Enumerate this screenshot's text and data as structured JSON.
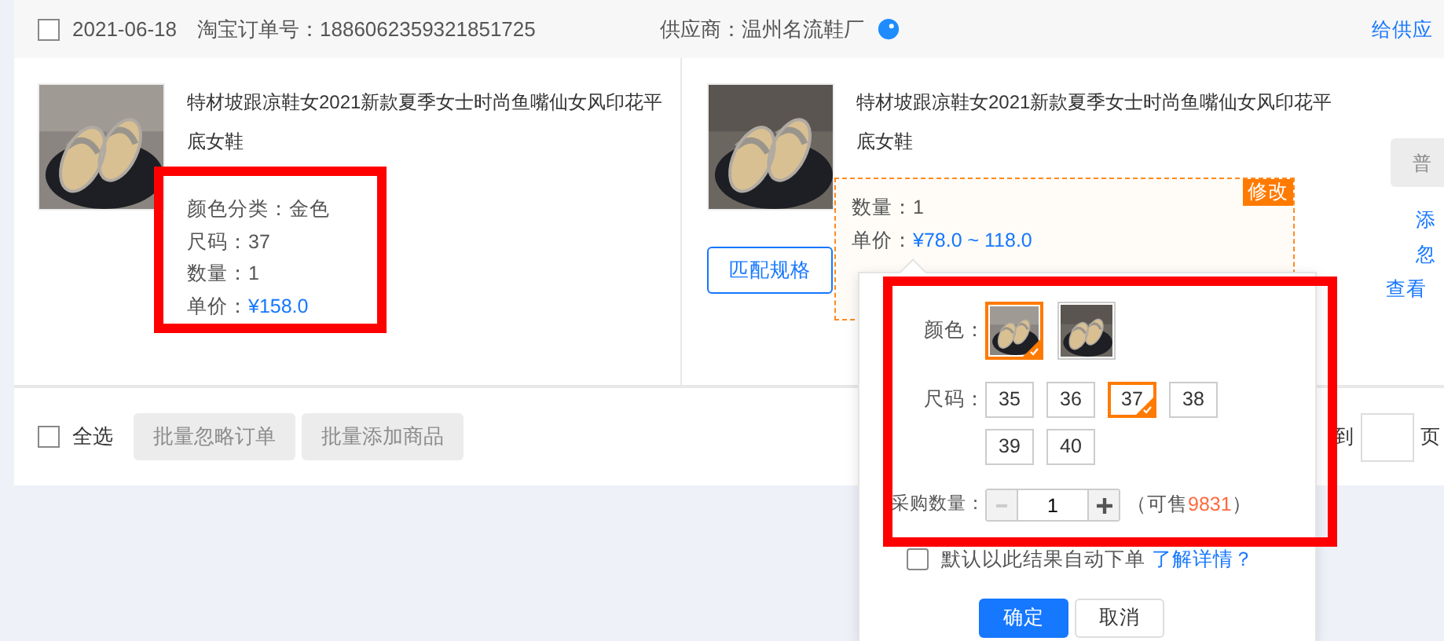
{
  "order_header": {
    "checked": false,
    "date": "2021-06-18",
    "order_no_label": "淘宝订单号：",
    "order_no": "1886062359321851725",
    "supplier": "供应商：温州名流鞋厂",
    "supplier_link": "给供应"
  },
  "source_item": {
    "title": "特材坡跟凉鞋女2021新款夏季女士时尚鱼嘴仙女风印花平底女鞋",
    "attributes": [
      {
        "label": "颜色分类：",
        "value": "金色",
        "kind": "plain"
      },
      {
        "label": "尺码：",
        "value": "37",
        "kind": "plain"
      },
      {
        "label": "数量：",
        "value": "1",
        "kind": "plain"
      },
      {
        "label": "单价：",
        "value": "¥158.0",
        "kind": "price"
      }
    ]
  },
  "matched_item": {
    "title": "特材坡跟凉鞋女2021新款夏季女士时尚鱼嘴仙女风印花平底女鞋",
    "edit_badge": "修改",
    "attributes": [
      {
        "label": "数量：",
        "value": "1",
        "kind": "plain"
      },
      {
        "label": "单价：",
        "value": "¥78.0 ~ 118.0",
        "kind": "price"
      }
    ],
    "match_button": "匹配规格"
  },
  "actions": {
    "button": "普",
    "links": [
      "添",
      "忽",
      "查看"
    ]
  },
  "footer": {
    "select_all": {
      "label": "全选",
      "checked": false
    },
    "buttons": [
      {
        "label": "批量忽略订单",
        "disabled": true
      },
      {
        "label": "批量添加商品",
        "disabled": true
      }
    ],
    "goto_label": "到",
    "page_label": "页"
  },
  "spec_popup": {
    "color_label": "颜色：",
    "colors": [
      {
        "selected": true
      },
      {
        "selected": false
      }
    ],
    "size_label": "尺码：",
    "sizes": [
      {
        "label": "35",
        "selected": false
      },
      {
        "label": "36",
        "selected": false
      },
      {
        "label": "37",
        "selected": true
      },
      {
        "label": "38",
        "selected": false
      },
      {
        "label": "39",
        "selected": false
      },
      {
        "label": "40",
        "selected": false
      }
    ],
    "qty_label": "采购数量：",
    "qty": "1",
    "stock_prefix": "（可售",
    "stock": "9831",
    "stock_suffix": "）",
    "auto_order": {
      "label": "默认以此结果自动下单",
      "checked": false,
      "link": "了解详情？"
    },
    "buttons": [
      {
        "label": "确定",
        "kind": "primary"
      },
      {
        "label": "取消",
        "kind": "secondary"
      }
    ]
  }
}
